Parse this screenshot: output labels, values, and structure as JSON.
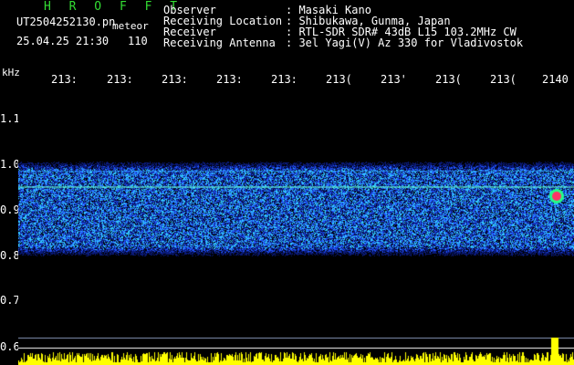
{
  "header": {
    "app_title": "H R O F F T",
    "filename": "UT2504252130.pn",
    "tag": "meteor",
    "timestamp": "25.04.25 21:30",
    "count": "110"
  },
  "meta": [
    {
      "label": "Observer",
      "value": ": Masaki Kano"
    },
    {
      "label": "Receiving Location",
      "value": ": Shibukawa, Gunma, Japan"
    },
    {
      "label": "Receiver",
      "value": ": RTL-SDR SDR# 43dB L15 103.2MHz CW"
    },
    {
      "label": "Receiving Antenna",
      "value": ": 3el Yagi(V) Az 330 for Vladivostok"
    }
  ],
  "axis": {
    "unit": "kHz",
    "x_ticks": [
      "213:",
      "213:",
      "213:",
      "213:",
      "213:",
      "213(",
      "213'",
      "213(",
      "213(",
      "2140"
    ],
    "y_ticks": [
      "1.1",
      "1.0",
      "0.9",
      "0.8",
      "0.7",
      "0.6"
    ]
  },
  "colors": {
    "background": "#000000",
    "noise_low": "#0a1a7a",
    "noise_mid": "#2255ff",
    "noise_high": "#33ccff",
    "echo": "#ff3366",
    "power_bar": "#ffff00",
    "title": "#33dd33"
  }
}
